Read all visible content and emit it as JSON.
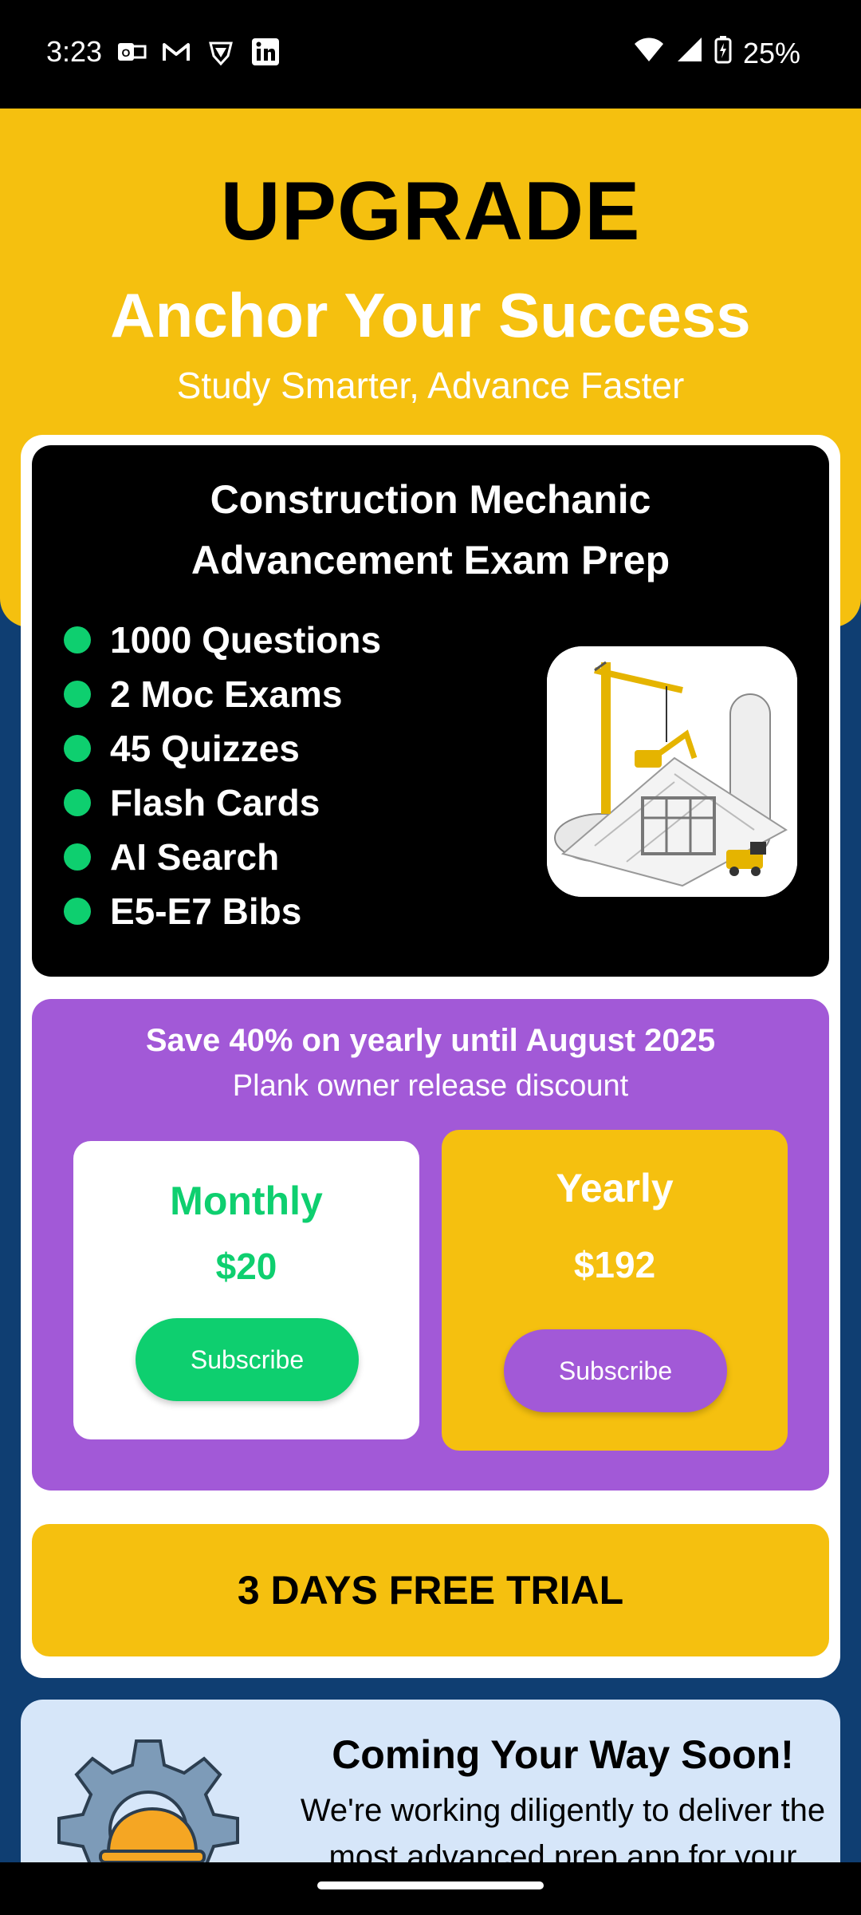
{
  "status_bar": {
    "time": "3:23",
    "battery": "25%",
    "left_icons": [
      "outlook-icon",
      "gmail-icon",
      "vpn-shield-icon",
      "linkedin-icon"
    ],
    "right_icons": [
      "wifi-icon",
      "signal-icon",
      "battery-charging-icon"
    ]
  },
  "header": {
    "title": "UPGRADE",
    "tagline": "Anchor Your Success",
    "subtagline": "Study Smarter, Advance Faster"
  },
  "product": {
    "title_line1": "Construction Mechanic",
    "title_line2": "Advancement Exam Prep",
    "features": [
      "1000 Questions",
      "2 Moc Exams",
      "45 Quizzes",
      "Flash Cards",
      "AI Search",
      "E5-E7 Bibs"
    ],
    "image_icon": "construction-crane-blueprint-image"
  },
  "pricing": {
    "promo_title": "Save 40% on yearly until August 2025",
    "promo_subtitle": "Plank owner release discount",
    "monthly": {
      "name": "Monthly",
      "price": "$20",
      "button": "Subscribe"
    },
    "yearly": {
      "name": "Yearly",
      "price": "$192",
      "button": "Subscribe"
    }
  },
  "trial": {
    "label": "3 DAYS FREE TRIAL"
  },
  "coming_soon": {
    "title": "Coming Your Way Soon!",
    "text": "We're working diligently to deliver the most advanced prep app for your",
    "image_icon": "gear-hardhat-icon"
  },
  "colors": {
    "accent_yellow": "#f5c00f",
    "purple": "#a259d7",
    "green": "#0ecf6f",
    "navy": "#0f3e72",
    "light_blue": "#d6e6f9"
  }
}
